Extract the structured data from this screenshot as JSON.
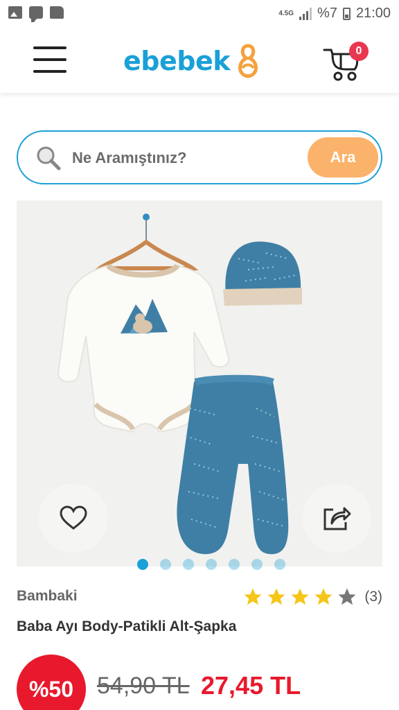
{
  "status_bar": {
    "network": "4.5G",
    "battery": "%7",
    "time": "21:00"
  },
  "header": {
    "logo_text": "ebebek",
    "cart_count": "0"
  },
  "search": {
    "placeholder": "Ne Aramıştınız?",
    "button_label": "Ara"
  },
  "gallery": {
    "image_count": 7,
    "active_index": 0
  },
  "product": {
    "brand": "Bambaki",
    "title": "Baba Ayı Body-Patikli Alt-Şapka",
    "rating_stars": 4,
    "rating_count": "(3)",
    "discount": "%50",
    "old_price": "54,90 TL",
    "new_price": "27,45 TL"
  },
  "colors": {
    "brand_blue": "#1aa0d8",
    "brand_orange": "#f4a23c",
    "search_button": "#fbb26b",
    "price_red": "#e8192c",
    "star_yellow": "#f5c518"
  }
}
